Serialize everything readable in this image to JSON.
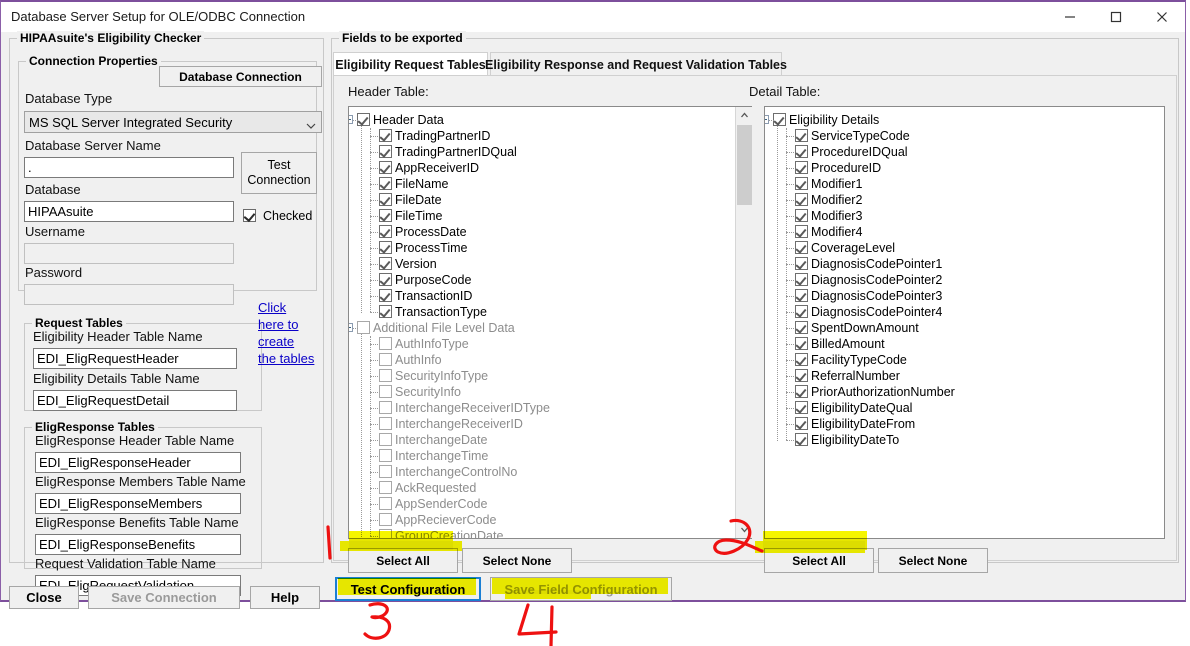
{
  "window": {
    "title": "Database Server Setup for OLE/ODBC Connection",
    "minimize_icon": "minimize-icon",
    "maximize_icon": "maximize-icon",
    "close_icon": "close-icon",
    "accent_color": "#7d4f9c"
  },
  "left": {
    "group_title": "HIPAAsuite's Eligibility Checker",
    "connection_properties": {
      "legend": "Connection Properties",
      "database_connection_button": "Database Connection",
      "database_type_label": "Database Type",
      "database_type_value": "MS SQL Server Integrated Security",
      "server_name_label": "Database Server Name",
      "server_name_value": ".",
      "database_label": "Database",
      "database_value": "HIPAAsuite",
      "username_label": "Username",
      "username_value": "",
      "password_label": "Password",
      "password_value": "",
      "test_connection_button": "Test\nConnection",
      "test_connection_line1": "Test",
      "test_connection_line2": "Connection",
      "checked_label": "Checked",
      "checked_state": true
    },
    "request_tables": {
      "legend": "Request Tables",
      "header_label": "Eligibility Header Table Name",
      "header_value": "EDI_EligRequestHeader",
      "details_label": "Eligibility Details Table Name",
      "details_value": "EDI_EligRequestDetail"
    },
    "create_link": "Click here to create the tables",
    "create_link_lines": [
      "Click",
      "here to",
      "create",
      "the tables"
    ],
    "response_tables": {
      "legend": "EligResponse Tables",
      "resp_header_label": "EligResponse Header Table Name",
      "resp_header_value": "EDI_EligResponseHeader",
      "resp_members_label": "EligResponse Members Table Name",
      "resp_members_value": "EDI_EligResponseMembers",
      "resp_benefits_label": "EligResponse Benefits Table Name",
      "resp_benefits_value": "EDI_EligResponseBenefits",
      "validation_label": "Request Validation Table Name",
      "validation_value": "EDI_EligRequestValidation"
    },
    "footer": {
      "close": "Close",
      "save_connection": "Save Connection",
      "help": "Help"
    }
  },
  "right": {
    "legend": "Fields to be exported",
    "tabs": [
      {
        "label": "Eligibility Request Tables",
        "active": true
      },
      {
        "label": "Eligibility Response and Request Validation Tables",
        "active": false
      }
    ],
    "header_table_label": "Header Table:",
    "detail_table_label": "Detail Table:",
    "header_tree": [
      {
        "label": "Header Data",
        "checked": true,
        "level": 0,
        "enabled": true,
        "expander": true
      },
      {
        "label": "TradingPartnerID",
        "checked": true,
        "level": 1,
        "enabled": true
      },
      {
        "label": "TradingPartnerIDQual",
        "checked": true,
        "level": 1,
        "enabled": true
      },
      {
        "label": "AppReceiverID",
        "checked": true,
        "level": 1,
        "enabled": true
      },
      {
        "label": "FileName",
        "checked": true,
        "level": 1,
        "enabled": true
      },
      {
        "label": "FileDate",
        "checked": true,
        "level": 1,
        "enabled": true
      },
      {
        "label": "FileTime",
        "checked": true,
        "level": 1,
        "enabled": true
      },
      {
        "label": "ProcessDate",
        "checked": true,
        "level": 1,
        "enabled": true
      },
      {
        "label": "ProcessTime",
        "checked": true,
        "level": 1,
        "enabled": true
      },
      {
        "label": "Version",
        "checked": true,
        "level": 1,
        "enabled": true
      },
      {
        "label": "PurposeCode",
        "checked": true,
        "level": 1,
        "enabled": true
      },
      {
        "label": "TransactionID",
        "checked": true,
        "level": 1,
        "enabled": true
      },
      {
        "label": "TransactionType",
        "checked": true,
        "level": 1,
        "enabled": true
      },
      {
        "label": "Additional File Level Data",
        "checked": false,
        "level": 0,
        "enabled": false,
        "expander": true
      },
      {
        "label": "AuthInfoType",
        "checked": false,
        "level": 1,
        "enabled": false
      },
      {
        "label": "AuthInfo",
        "checked": false,
        "level": 1,
        "enabled": false
      },
      {
        "label": "SecurityInfoType",
        "checked": false,
        "level": 1,
        "enabled": false
      },
      {
        "label": "SecurityInfo",
        "checked": false,
        "level": 1,
        "enabled": false
      },
      {
        "label": "InterchangeReceiverIDType",
        "checked": false,
        "level": 1,
        "enabled": false
      },
      {
        "label": "InterchangeReceiverID",
        "checked": false,
        "level": 1,
        "enabled": false
      },
      {
        "label": "InterchangeDate",
        "checked": false,
        "level": 1,
        "enabled": false
      },
      {
        "label": "InterchangeTime",
        "checked": false,
        "level": 1,
        "enabled": false
      },
      {
        "label": "InterchangeControlNo",
        "checked": false,
        "level": 1,
        "enabled": false
      },
      {
        "label": "AckRequested",
        "checked": false,
        "level": 1,
        "enabled": false
      },
      {
        "label": "AppSenderCode",
        "checked": false,
        "level": 1,
        "enabled": false
      },
      {
        "label": "AppRecieverCode",
        "checked": false,
        "level": 1,
        "enabled": false
      },
      {
        "label": "GroupCreationDate",
        "checked": false,
        "level": 1,
        "enabled": false
      }
    ],
    "detail_tree": [
      {
        "label": "Eligibility Details",
        "checked": true,
        "level": 0,
        "enabled": true,
        "expander": true
      },
      {
        "label": "ServiceTypeCode",
        "checked": true,
        "level": 1,
        "enabled": true
      },
      {
        "label": "ProcedureIDQual",
        "checked": true,
        "level": 1,
        "enabled": true
      },
      {
        "label": "ProcedureID",
        "checked": true,
        "level": 1,
        "enabled": true
      },
      {
        "label": "Modifier1",
        "checked": true,
        "level": 1,
        "enabled": true
      },
      {
        "label": "Modifier2",
        "checked": true,
        "level": 1,
        "enabled": true
      },
      {
        "label": "Modifier3",
        "checked": true,
        "level": 1,
        "enabled": true
      },
      {
        "label": "Modifier4",
        "checked": true,
        "level": 1,
        "enabled": true
      },
      {
        "label": "CoverageLevel",
        "checked": true,
        "level": 1,
        "enabled": true
      },
      {
        "label": "DiagnosisCodePointer1",
        "checked": true,
        "level": 1,
        "enabled": true
      },
      {
        "label": "DiagnosisCodePointer2",
        "checked": true,
        "level": 1,
        "enabled": true
      },
      {
        "label": "DiagnosisCodePointer3",
        "checked": true,
        "level": 1,
        "enabled": true
      },
      {
        "label": "DiagnosisCodePointer4",
        "checked": true,
        "level": 1,
        "enabled": true
      },
      {
        "label": "SpentDownAmount",
        "checked": true,
        "level": 1,
        "enabled": true
      },
      {
        "label": "BilledAmount",
        "checked": true,
        "level": 1,
        "enabled": true
      },
      {
        "label": "FacilityTypeCode",
        "checked": true,
        "level": 1,
        "enabled": true
      },
      {
        "label": "ReferralNumber",
        "checked": true,
        "level": 1,
        "enabled": true
      },
      {
        "label": "PriorAuthorizationNumber",
        "checked": true,
        "level": 1,
        "enabled": true
      },
      {
        "label": "EligibilityDateQual",
        "checked": true,
        "level": 1,
        "enabled": true
      },
      {
        "label": "EligibilityDateFrom",
        "checked": true,
        "level": 1,
        "enabled": true
      },
      {
        "label": "EligibilityDateTo",
        "checked": true,
        "level": 1,
        "enabled": true
      }
    ],
    "header_select_all": "Select All",
    "header_select_none": "Select None",
    "detail_select_all": "Select All",
    "detail_select_none": "Select None",
    "test_configuration": "Test Configuration",
    "save_field_configuration": "Save Field Configuration"
  },
  "annotations": {
    "highlight_color": "#f5f500",
    "ink_color": "#ee1111",
    "marks": [
      "1",
      "2",
      "3",
      "4"
    ]
  }
}
